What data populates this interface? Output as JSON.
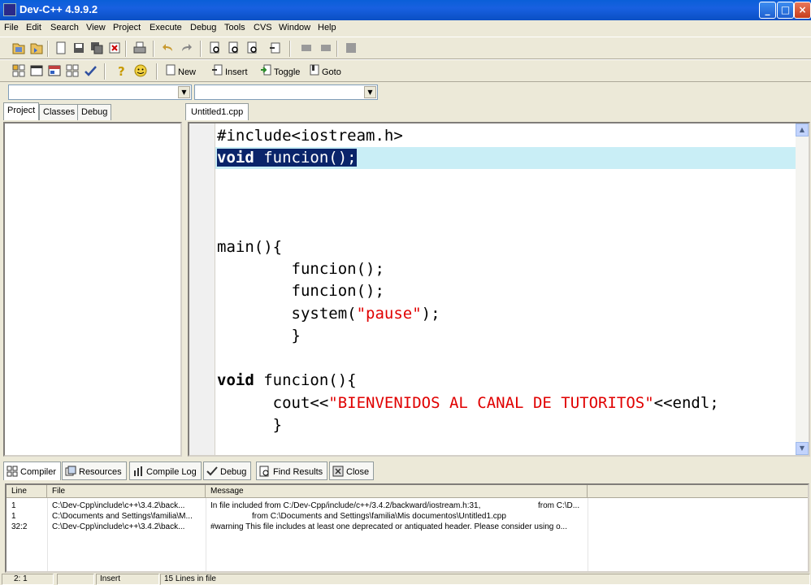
{
  "window": {
    "title": "Dev-C++ 4.9.9.2"
  },
  "menu": [
    "File",
    "Edit",
    "Search",
    "View",
    "Project",
    "Execute",
    "Debug",
    "Tools",
    "CVS",
    "Window",
    "Help"
  ],
  "toolbar2": {
    "new_label": "New",
    "insert_label": "Insert",
    "toggle_label": "Toggle",
    "goto_label": "Goto"
  },
  "left_tabs": [
    "Project",
    "Classes",
    "Debug"
  ],
  "editor": {
    "tab": "Untitled1.cpp",
    "lines": {
      "l1": "#include<iostream.h>",
      "l2_kw": "void",
      "l2_rest": " funcion();",
      "l6": "main(){",
      "l7": "        funcion();",
      "l8": "        funcion();",
      "l9_a": "        system(",
      "l9_str": "\"pause\"",
      "l9_b": ");",
      "l10": "        }",
      "l12_kw": "void",
      "l12_rest": " funcion(){",
      "l13_a": "      cout<<",
      "l13_str": "\"BIENVENIDOS AL CANAL DE TUTORITOS\"",
      "l13_b": "<<endl;",
      "l14": "      }"
    }
  },
  "bottom_tabs": [
    "Compiler",
    "Resources",
    "Compile Log",
    "Debug",
    "Find Results",
    "Close"
  ],
  "messages": {
    "headers": [
      "Line",
      "File",
      "Message"
    ],
    "rows": [
      [
        "1",
        "C:\\Dev-Cpp\\include\\c++\\3.4.2\\back...",
        "In file included from C:/Dev-Cpp/include/c++/3.4.2/backward/iostream.h:31,",
        "from C:\\D..."
      ],
      [
        "1",
        "C:\\Documents and Settings\\familia\\M...",
        "from C:\\Documents and Settings\\familia\\Mis documentos\\Untitled1.cpp",
        ""
      ],
      [
        "32:2",
        "C:\\Dev-Cpp\\include\\c++\\3.4.2\\back...",
        "#warning This file includes at least one deprecated or antiquated header. Please consider using o...",
        ""
      ]
    ]
  },
  "status": {
    "position": "2: 1",
    "mode": "Insert",
    "lines": "15 Lines in file"
  }
}
